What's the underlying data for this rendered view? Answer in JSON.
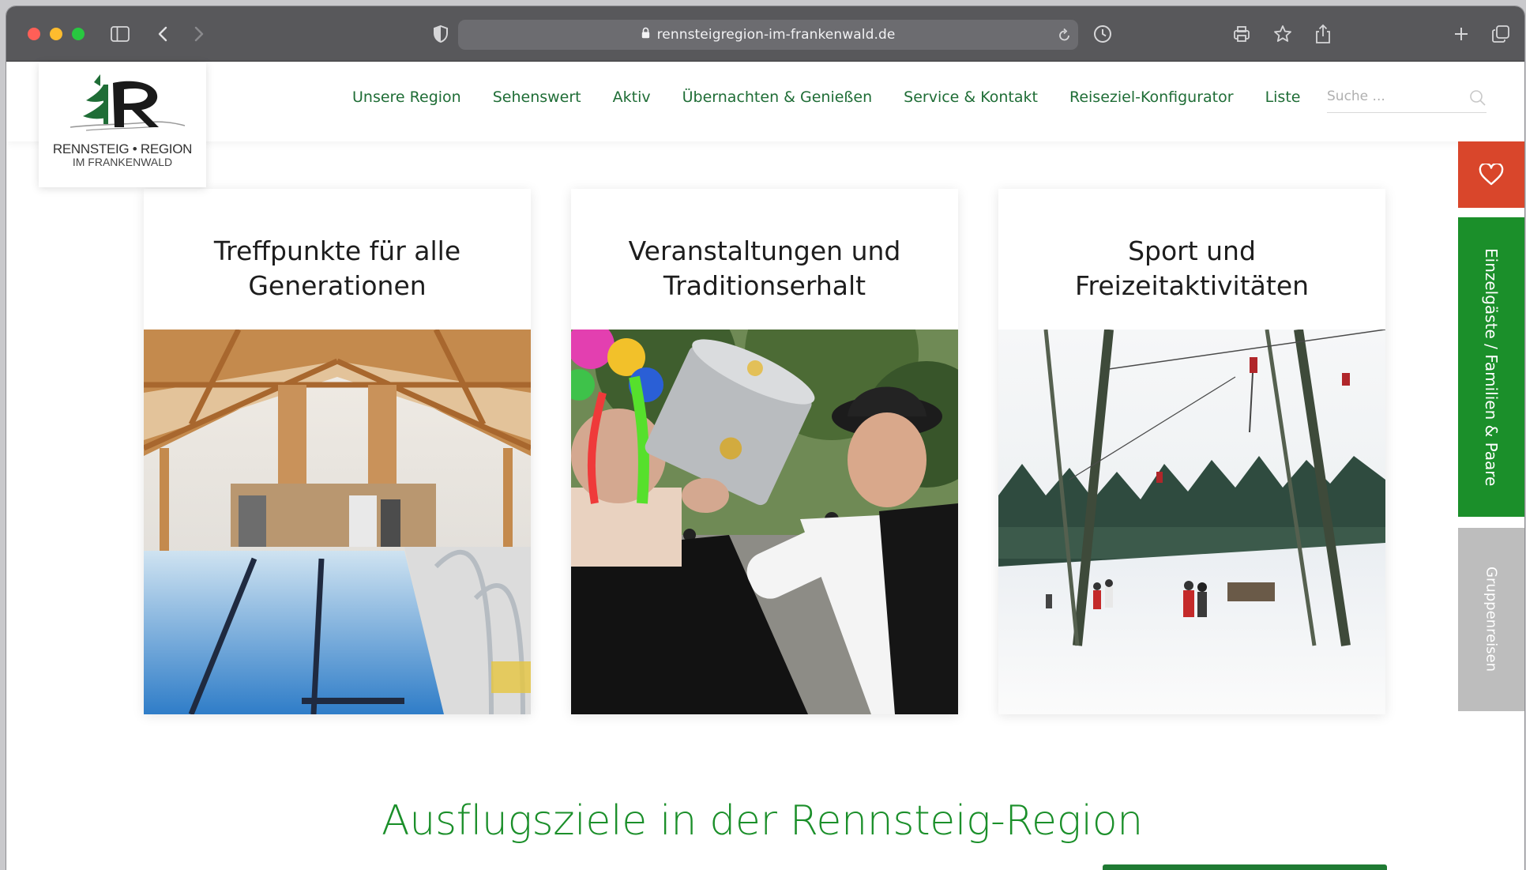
{
  "browser": {
    "url": "rennsteigregion-im-frankenwald.de",
    "icons": [
      "sidebar-icon",
      "back-icon",
      "forward-icon",
      "shield-icon",
      "lock-icon",
      "reload-icon",
      "history-icon",
      "print-icon",
      "bookmark-star-icon",
      "share-icon",
      "new-tab-icon",
      "tabs-overview-icon"
    ]
  },
  "site": {
    "logo": {
      "line1": "RENNSTEIG • REGION",
      "line2": "IM FRANKENWALD"
    },
    "nav": [
      {
        "label": "Unsere Region"
      },
      {
        "label": "Sehenswert"
      },
      {
        "label": "Aktiv"
      },
      {
        "label": "Übernachten & Genießen"
      },
      {
        "label": "Service & Kontakt"
      },
      {
        "label": "Reiseziel-Konfigurator"
      },
      {
        "label": "Liste"
      }
    ],
    "search": {
      "placeholder": "Suche ..."
    },
    "cards": [
      {
        "title_line1": "Treffpunkte für alle",
        "title_line2": "Generationen"
      },
      {
        "title_line1": "Veranstaltungen und",
        "title_line2": "Traditionserhalt"
      },
      {
        "title_line1": "Sport und",
        "title_line2": "Freizeitaktivitäten"
      }
    ],
    "side_tabs": {
      "favorites_icon": "heart-icon",
      "tab1": "Einzelgäste / Familien & Paare",
      "tab2": "Gruppenreisen"
    },
    "section_title": "Ausflugsziele in der Rennsteig-Region",
    "colors": {
      "brand_green": "#1b8f2a",
      "nav_green": "#1f6d36",
      "favorites_red": "#d9462b",
      "group_tab_gray": "#bdbdbd"
    }
  }
}
